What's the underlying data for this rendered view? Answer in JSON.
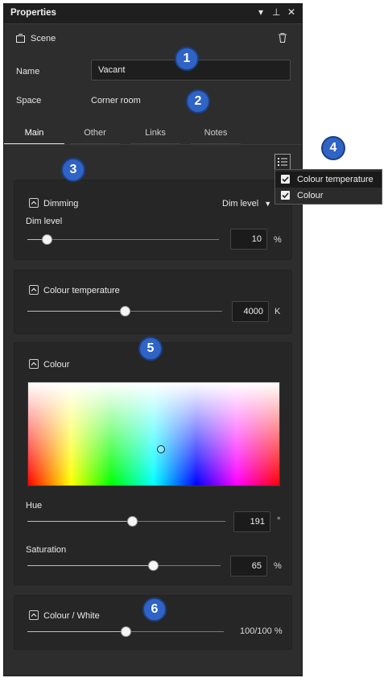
{
  "panel": {
    "title": "Properties",
    "controls": {
      "dropdown": "▾",
      "pin": "⊥",
      "close": "✕"
    }
  },
  "scene": {
    "label": "Scene",
    "icon": "scene-icon",
    "delete_icon": "trash-icon"
  },
  "fields": {
    "name_label": "Name",
    "name_value": "Vacant",
    "space_label": "Space",
    "space_value": "Corner room"
  },
  "tabs": [
    {
      "label": "Main",
      "active": true
    },
    {
      "label": "Other",
      "active": false
    },
    {
      "label": "Links",
      "active": false
    },
    {
      "label": "Notes",
      "active": false
    }
  ],
  "section_menu": {
    "icon": "list-icon",
    "items": [
      {
        "label": "Colour temperature",
        "checked": true,
        "highlighted": true
      },
      {
        "label": "Colour",
        "checked": true,
        "highlighted": false
      }
    ]
  },
  "dimming": {
    "title": "Dimming",
    "mode": "Dim level",
    "slider_label": "Dim level",
    "value": "10",
    "unit": "%",
    "fraction": 0.1
  },
  "colour_temperature": {
    "title": "Colour temperature",
    "value": "4000",
    "unit": "K",
    "fraction": 0.5
  },
  "colour": {
    "title": "Colour",
    "hue_label": "Hue",
    "hue_value": "191",
    "hue_unit": "°",
    "hue_fraction": 0.53,
    "saturation_label": "Saturation",
    "saturation_value": "65",
    "saturation_unit": "%",
    "saturation_fraction": 0.65
  },
  "colour_white": {
    "title": "Colour / White",
    "value_text": "100/100 %",
    "fraction": 0.5
  },
  "badges": [
    "1",
    "2",
    "3",
    "4",
    "5",
    "6"
  ],
  "colors": {
    "panel_bg": "#2d2d2d",
    "card_bg": "#262626",
    "badge": "#2f63c5",
    "text": "#e6e6e6"
  }
}
